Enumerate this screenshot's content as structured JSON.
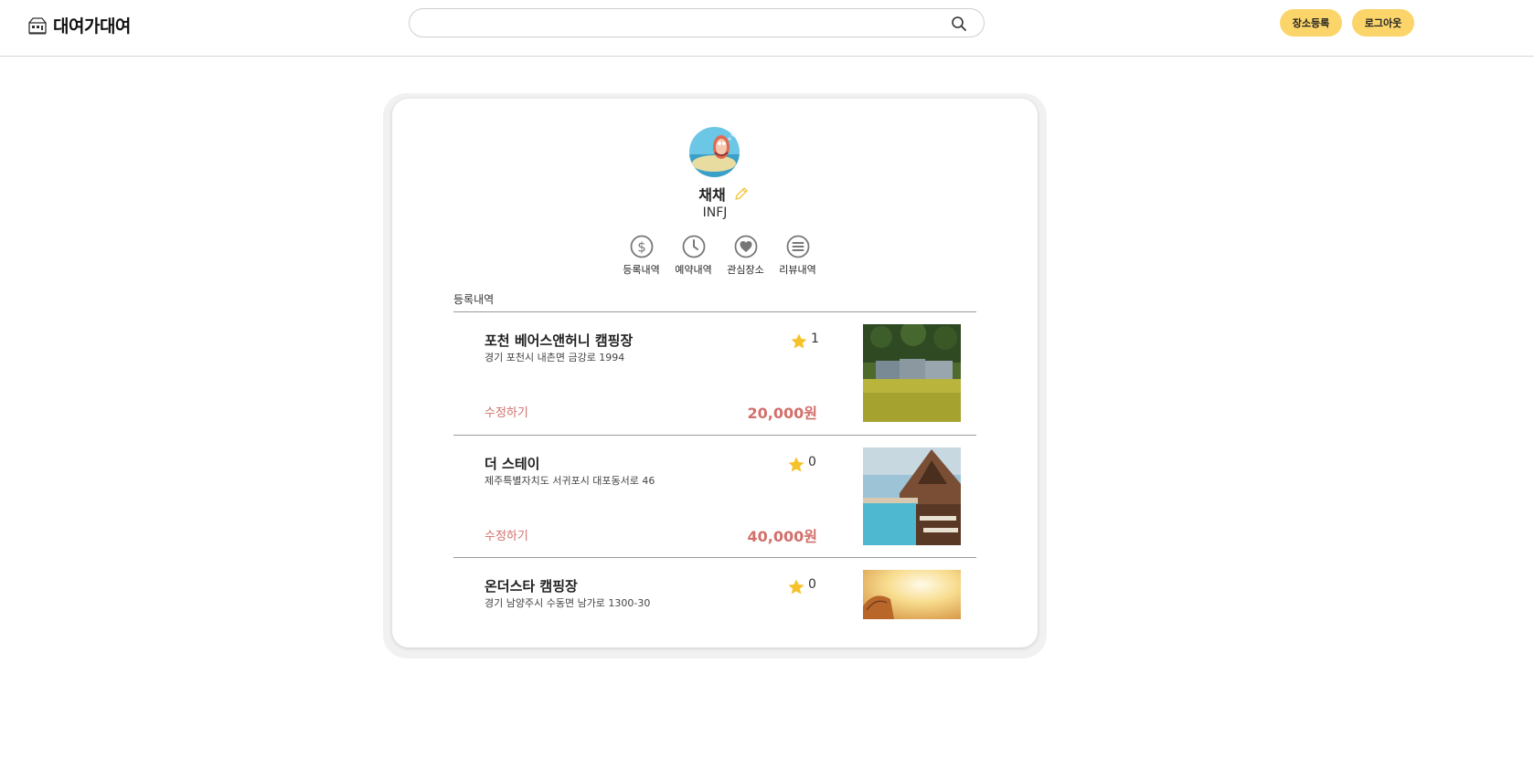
{
  "header": {
    "logo_text": "대여가대여",
    "search_placeholder": "",
    "register_place_label": "장소등록",
    "logout_label": "로그아웃"
  },
  "profile": {
    "name": "채채",
    "mbti": "INFJ"
  },
  "menu": [
    {
      "label": "등록내역",
      "icon": "dollar-circle-icon"
    },
    {
      "label": "예약내역",
      "icon": "clock-icon"
    },
    {
      "label": "관심장소",
      "icon": "heart-circle-icon"
    },
    {
      "label": "리뷰내역",
      "icon": "list-circle-icon"
    }
  ],
  "section_title": "등록내역",
  "items": [
    {
      "title": "포천 베어스앤허니 캠핑장",
      "address": "경기 포천시 내촌면 금강로 1994",
      "rating": "1",
      "edit_label": "수정하기",
      "price": "20,000원"
    },
    {
      "title": "더 스테이",
      "address": "제주특별자치도 서귀포시 대포동서로 46",
      "rating": "0",
      "edit_label": "수정하기",
      "price": "40,000원"
    },
    {
      "title": "온더스타 캠핑장",
      "address": "경기 남양주시 수동면 남가로 1300-30",
      "rating": "0",
      "edit_label": "",
      "price": ""
    }
  ],
  "colors": {
    "accent_yellow": "#fcd56a",
    "price_red": "#d2706b",
    "star": "#f6c22a"
  }
}
